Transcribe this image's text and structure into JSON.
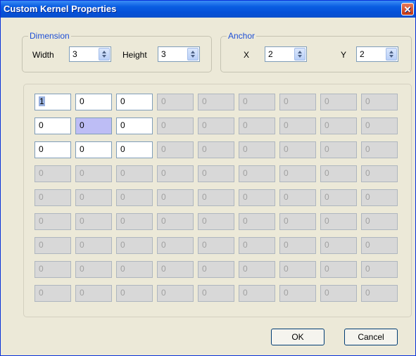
{
  "window": {
    "title": "Custom Kernel Properties",
    "close_icon": "close-icon"
  },
  "dimension": {
    "legend": "Dimension",
    "width_label": "Width",
    "width_value": "3",
    "height_label": "Height",
    "height_value": "3"
  },
  "anchor": {
    "legend": "Anchor",
    "x_label": "X",
    "x_value": "2",
    "y_label": "Y",
    "y_value": "2"
  },
  "kernel": {
    "rows": 9,
    "cols": 9,
    "active_rows": 3,
    "active_cols": 3,
    "values": [
      [
        "1",
        "0",
        "0",
        "0",
        "0",
        "0",
        "0",
        "0",
        "0"
      ],
      [
        "0",
        "0",
        "0",
        "0",
        "0",
        "0",
        "0",
        "0",
        "0"
      ],
      [
        "0",
        "0",
        "0",
        "0",
        "0",
        "0",
        "0",
        "0",
        "0"
      ],
      [
        "0",
        "0",
        "0",
        "0",
        "0",
        "0",
        "0",
        "0",
        "0"
      ],
      [
        "0",
        "0",
        "0",
        "0",
        "0",
        "0",
        "0",
        "0",
        "0"
      ],
      [
        "0",
        "0",
        "0",
        "0",
        "0",
        "0",
        "0",
        "0",
        "0"
      ],
      [
        "0",
        "0",
        "0",
        "0",
        "0",
        "0",
        "0",
        "0",
        "0"
      ],
      [
        "0",
        "0",
        "0",
        "0",
        "0",
        "0",
        "0",
        "0",
        "0"
      ],
      [
        "0",
        "0",
        "0",
        "0",
        "0",
        "0",
        "0",
        "0",
        "0"
      ]
    ],
    "focused_cell": [
      0,
      0
    ],
    "selected_cell": [
      1,
      1
    ]
  },
  "buttons": {
    "ok": "OK",
    "cancel": "Cancel"
  },
  "colors": {
    "titlebar": "#0a5ee2",
    "legend_text": "#1e4fd6",
    "selected_cell": "#bdbdf5",
    "disabled_cell": "#d8d8d8"
  }
}
